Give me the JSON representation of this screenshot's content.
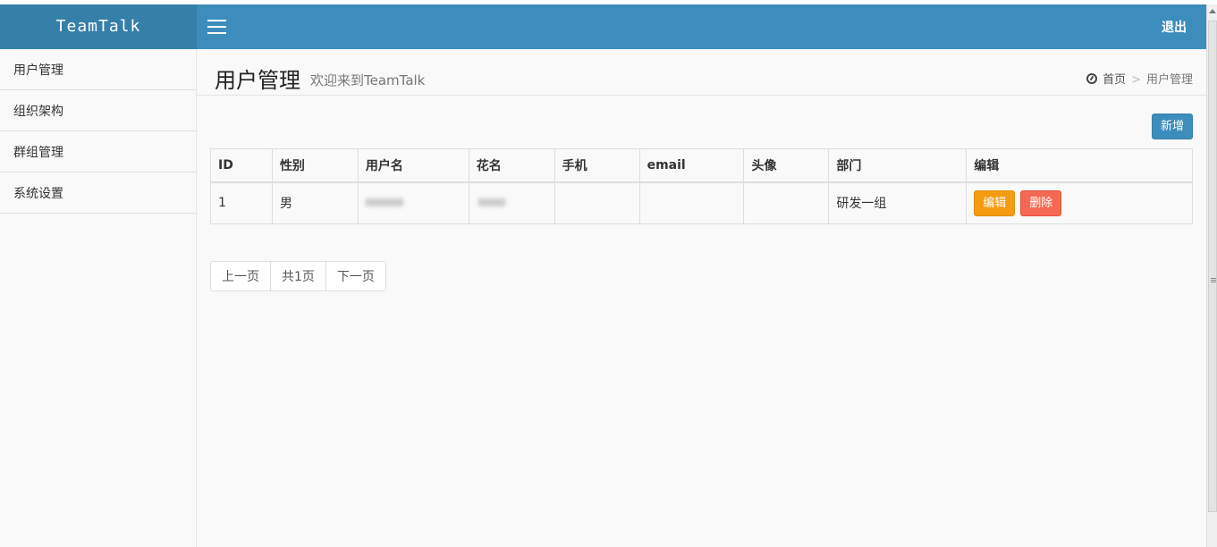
{
  "app": {
    "logo": "TeamTalk",
    "logout_label": "退出"
  },
  "sidebar": {
    "items": [
      {
        "label": "用户管理"
      },
      {
        "label": "组织架构"
      },
      {
        "label": "群组管理"
      },
      {
        "label": "系统设置"
      }
    ]
  },
  "header": {
    "title": "用户管理",
    "subtitle": "欢迎来到TeamTalk",
    "breadcrumb": {
      "home": "首页",
      "separator": ">",
      "current": "用户管理"
    }
  },
  "toolbar": {
    "add_label": "新增"
  },
  "table": {
    "columns": [
      "ID",
      "性别",
      "用户名",
      "花名",
      "手机",
      "email",
      "头像",
      "部门",
      "编辑"
    ],
    "rows": [
      {
        "id": "1",
        "gender": "男",
        "username": "",
        "nickname": "",
        "phone": "",
        "email": "",
        "avatar": "",
        "department": "研发一组",
        "edit_label": "编辑",
        "delete_label": "删除"
      }
    ]
  },
  "pagination": {
    "prev": "上一页",
    "total": "共1页",
    "next": "下一页"
  },
  "colors": {
    "header": "#3c8dbc",
    "logo": "#367fa9",
    "edit": "#f39c12",
    "delete": "#f56954"
  }
}
